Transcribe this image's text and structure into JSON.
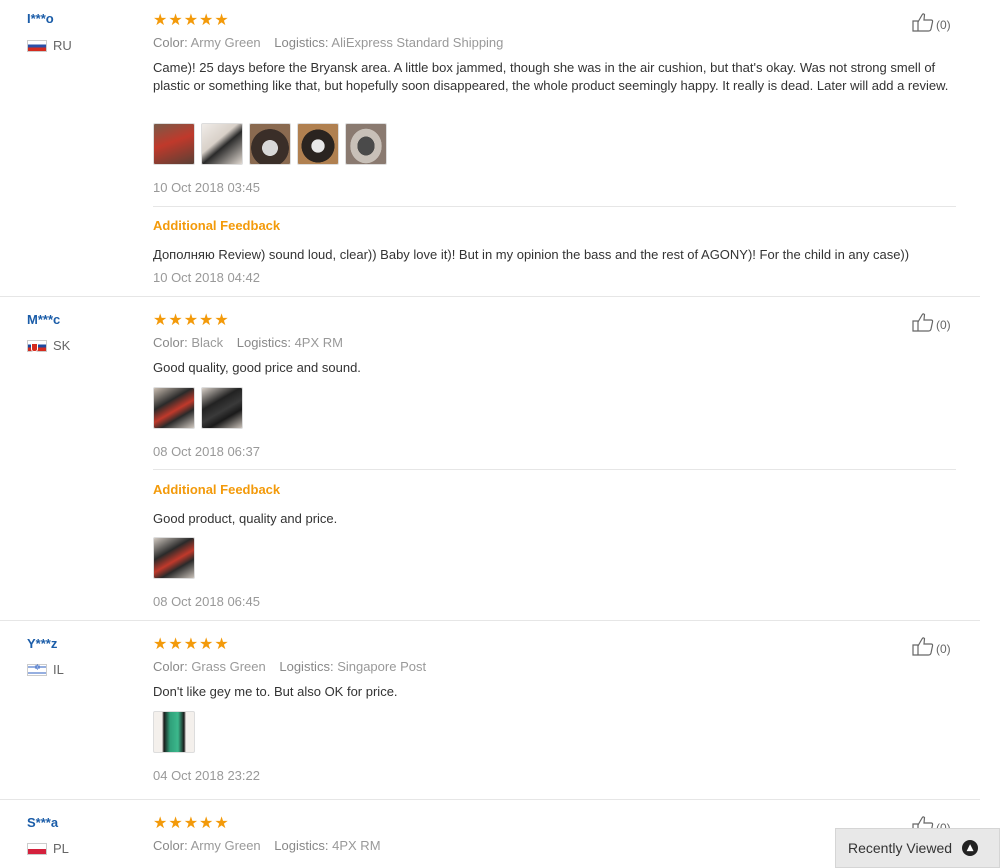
{
  "helpful_label": "(0)",
  "color_key": "Color:",
  "logistics_key": "Logistics:",
  "additional_feedback_label": "Additional Feedback",
  "stars": "★★★★★",
  "recently_viewed": "Recently Viewed",
  "reviews": [
    {
      "user": "I***o",
      "country": "RU",
      "color": "Army Green",
      "logistics": "AliExpress Standard Shipping",
      "text": "Came)! 25 days before the Bryansk area. A little box jammed, though she was in the air cushion, but that's okay. Was not strong smell of plastic or something like that, but hopefully soon disappeared, the whole product seemingly happy. It really is dead. Later will add a review.",
      "date": "10 Oct 2018 03:45",
      "additional_text": "Дополняю Review) sound loud, clear)) Baby love it)! But in my opinion the bass and the rest of AGONY)! For the child in any case))",
      "additional_date": "10 Oct 2018 04:42"
    },
    {
      "user": "M***c",
      "country": "SK",
      "color": "Black",
      "logistics": "4PX RM",
      "text": "Good quality, good price and sound.",
      "date": "08 Oct 2018 06:37",
      "additional_text": "Good product, quality and price.",
      "additional_date": "08 Oct 2018 06:45"
    },
    {
      "user": "Y***z",
      "country": "IL",
      "color": "Grass Green",
      "logistics": "Singapore Post",
      "text": "Don't like gey me to. But also OK for price.",
      "date": "04 Oct 2018 23:22"
    },
    {
      "user": "S***a",
      "country": "PL",
      "color": "Army Green",
      "logistics": "4PX RM"
    }
  ]
}
